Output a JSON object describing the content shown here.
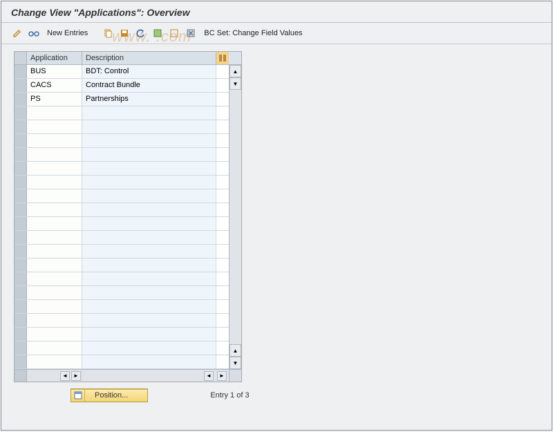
{
  "title": "Change View \"Applications\": Overview",
  "toolbar": {
    "new_entries": "New Entries",
    "bc_set": "BC Set: Change Field Values"
  },
  "table": {
    "columns": {
      "application": "Application",
      "description": "Description"
    },
    "rows": [
      {
        "application": "BUS",
        "description": "BDT: Control"
      },
      {
        "application": "CACS",
        "description": "Contract Bundle"
      },
      {
        "application": "PS",
        "description": "Partnerships"
      }
    ],
    "empty_row_count": 19
  },
  "footer": {
    "position_label": "Position...",
    "entry_status": "Entry 1 of 3"
  },
  "watermark": "www.                       .com"
}
